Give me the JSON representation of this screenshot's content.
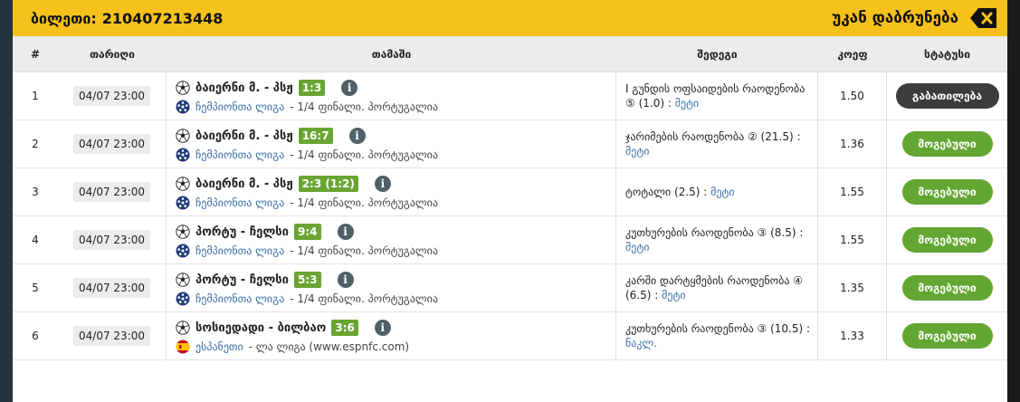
{
  "header": {
    "ticket_label": "ბილეთი:",
    "ticket_number": "210407213448",
    "back_label": "უკან დაბრუნება"
  },
  "columns": [
    "#",
    "თარიღი",
    "თამაში",
    "შედეგი",
    "კოეფ",
    "სტატუსი"
  ],
  "rows": [
    {
      "num": "1",
      "date": "04/07 23:00",
      "match": "ბაიერნი მ. - პსჟ",
      "score": "1:3",
      "league": "ჩემპიონთა ლიგა",
      "stage": "- 1/4 ფინალი. პორტუგალია",
      "result_text": "I გუნდის ოფსაიდების რაოდენობა ⑤ (1.0) :",
      "result_pick": "მეტი",
      "odd": "1.50",
      "status": "გაბათილება",
      "status_color": "#3c3c3c"
    },
    {
      "num": "2",
      "date": "04/07 23:00",
      "match": "ბაიერნი მ. - პსჟ",
      "score": "16:7",
      "league": "ჩემპიონთა ლიგა",
      "stage": "- 1/4 ფინალი. პორტუგალია",
      "result_text": "ჯარიმების რაოდენობა ② (21.5) :",
      "result_pick": "მეტი",
      "odd": "1.36",
      "status": "მოგებული",
      "status_color": "#64a632"
    },
    {
      "num": "3",
      "date": "04/07 23:00",
      "match": "ბაიერნი მ. - პსჟ",
      "score": "2:3 (1:2)",
      "league": "ჩემპიონთა ლიგა",
      "stage": "- 1/4 ფინალი. პორტუგალია",
      "result_text": "ტოტალი (2.5) :",
      "result_pick": "მეტი",
      "odd": "1.55",
      "status": "მოგებული",
      "status_color": "#64a632"
    },
    {
      "num": "4",
      "date": "04/07 23:00",
      "match": "პორტუ - ჩელსი",
      "score": "9:4",
      "league": "ჩემპიონთა ლიგა",
      "stage": "- 1/4 ფინალი. პორტუგალია",
      "result_text": "კუთხურების რაოდენობა ③ (8.5) :",
      "result_pick": "მეტი",
      "odd": "1.55",
      "status": "მოგებული",
      "status_color": "#64a632"
    },
    {
      "num": "5",
      "date": "04/07 23:00",
      "match": "პორტუ - ჩელსი",
      "score": "5:3",
      "league": "ჩემპიონთა ლიგა",
      "stage": "- 1/4 ფინალი. პორტუგალია",
      "result_text": "კარში დარტყმების რაოდენობა ④ (6.5) :",
      "result_pick": "მეტი",
      "odd": "1.35",
      "status": "მოგებული",
      "status_color": "#64a632"
    },
    {
      "num": "6",
      "date": "04/07 23:00",
      "match": "სოსიედადი - ბილბაო",
      "score": "3:6",
      "league": "ესპანეთი",
      "stage": "- ლა ლიგა (www.espnfc.com)",
      "result_text": "კუთხურების რაოდენობა ③ (10.5) :",
      "result_pick": "ნაკლ.",
      "odd": "1.33",
      "status": "მოგებული",
      "status_color": "#64a632",
      "flag": "spain-flag-icon"
    }
  ],
  "icons": {
    "sport": "soccer-ball-icon",
    "league": "champions-league-icon",
    "info": "info-icon",
    "close": "close-icon"
  },
  "colors": {
    "header_bg": "#f6c11a",
    "score_bg": "#6aa533",
    "won": "#64a632",
    "cashout": "#3c3c3c",
    "link": "#3a6ea5"
  }
}
